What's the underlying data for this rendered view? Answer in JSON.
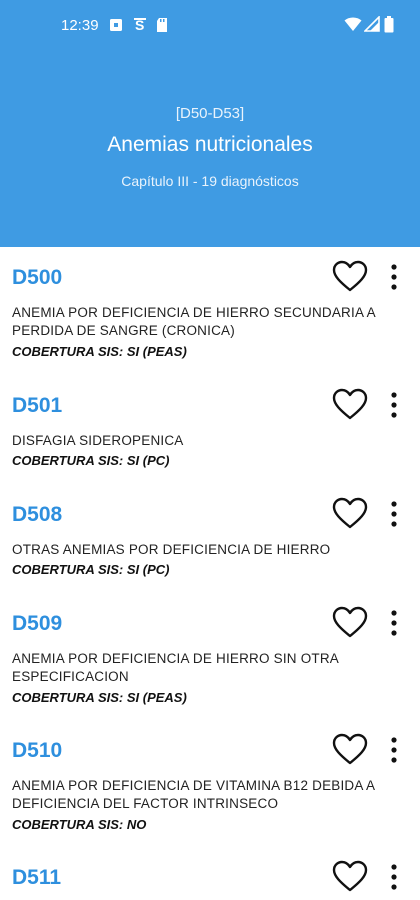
{
  "status_bar": {
    "time": "12:39",
    "icons_left": [
      "notification-square-icon",
      "s-app-icon",
      "sd-card-icon"
    ],
    "icons_right": [
      "wifi-icon",
      "signal-icon",
      "battery-icon"
    ]
  },
  "header": {
    "range": "[D50-D53]",
    "title": "Anemias nutricionales",
    "subtitle": "Capítulo III - 19 diagnósticos",
    "color": "#3f9be3"
  },
  "items": [
    {
      "code": "D500",
      "description": "ANEMIA POR DEFICIENCIA DE HIERRO SECUNDARIA A PERDIDA DE SANGRE (CRONICA)",
      "coverage": "COBERTURA SIS: SI (PEAS)"
    },
    {
      "code": "D501",
      "description": "DISFAGIA SIDEROPENICA",
      "coverage": "COBERTURA SIS: SI (PC)"
    },
    {
      "code": "D508",
      "description": "OTRAS ANEMIAS POR DEFICIENCIA DE HIERRO",
      "coverage": "COBERTURA SIS: SI (PC)"
    },
    {
      "code": "D509",
      "description": "ANEMIA POR DEFICIENCIA DE HIERRO SIN OTRA ESPECIFICACION",
      "coverage": "COBERTURA SIS: SI (PEAS)"
    },
    {
      "code": "D510",
      "description": "ANEMIA POR DEFICIENCIA DE VITAMINA B12 DEBIDA A DEFICIENCIA DEL FACTOR INTRINSECO",
      "coverage": "COBERTURA SIS: NO"
    },
    {
      "code": "D511",
      "description": "",
      "coverage": ""
    }
  ],
  "colors": {
    "code": "#2e8fde",
    "text": "#222222"
  }
}
